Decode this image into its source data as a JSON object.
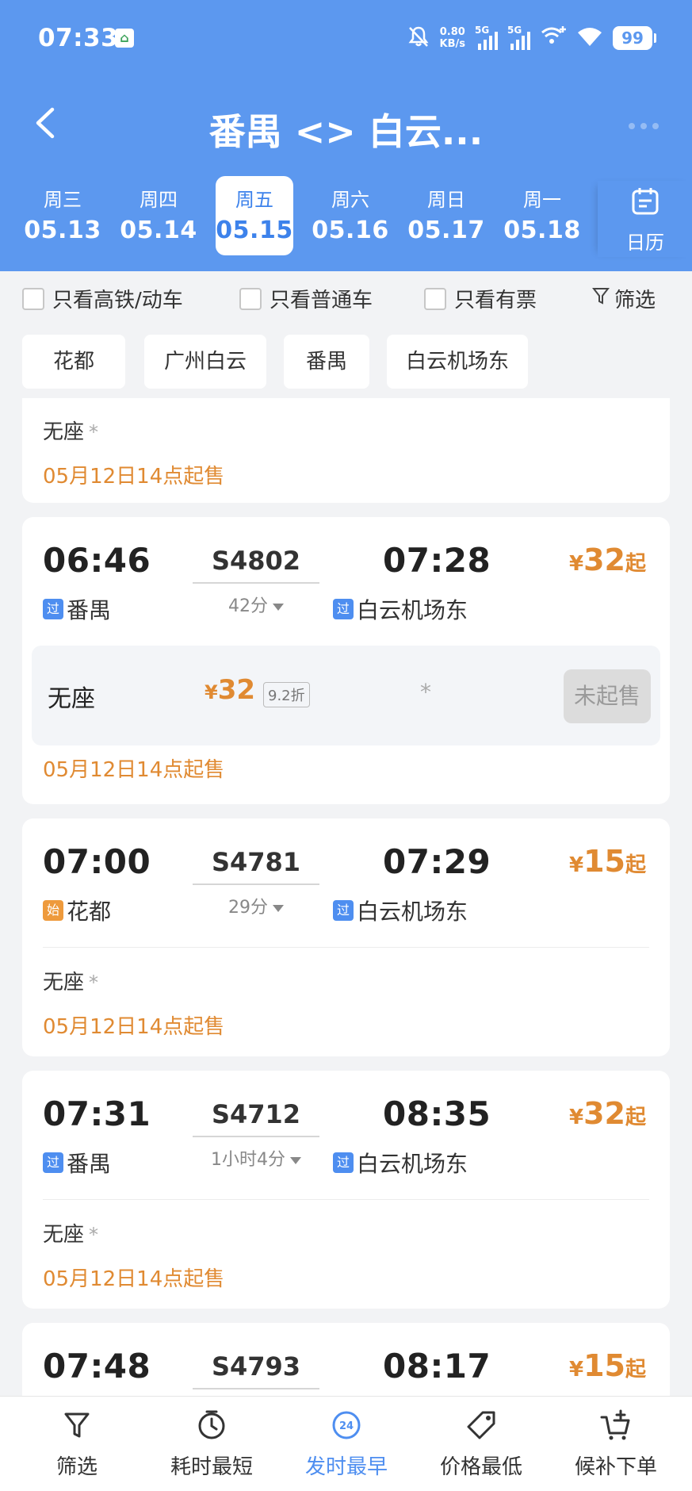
{
  "status_bar": {
    "time": "07:33",
    "net_speed_value": "0.80",
    "net_speed_unit": "KB/s",
    "sim1": "5G",
    "sim2": "5G",
    "battery": "99"
  },
  "header": {
    "title": "番禺 <> 白云...",
    "calendar_label": "日历",
    "dates": [
      {
        "weekday": "周三",
        "date": "05.13",
        "selected": false
      },
      {
        "weekday": "周四",
        "date": "05.14",
        "selected": false
      },
      {
        "weekday": "周五",
        "date": "05.15",
        "selected": true
      },
      {
        "weekday": "周六",
        "date": "05.16",
        "selected": false
      },
      {
        "weekday": "周日",
        "date": "05.17",
        "selected": false
      },
      {
        "weekday": "周一",
        "date": "05.18",
        "selected": false
      }
    ]
  },
  "filters": {
    "high_speed": "只看高铁/动车",
    "regular": "只看普通车",
    "available": "只看有票",
    "filter_button": "筛选"
  },
  "stations": [
    "花都",
    "广州白云",
    "番禺",
    "白云机场东"
  ],
  "partial_card": {
    "seat": "无座",
    "star": "*",
    "sale_notice": "05月12日14点起售"
  },
  "trains": [
    {
      "depart_time": "06:46",
      "train_no": "S4802",
      "arrive_time": "07:28",
      "duration": "42分",
      "from_badge": "过",
      "from_station": "番禺",
      "to_badge": "过",
      "to_station": "白云机场东",
      "price_symbol": "¥",
      "price": "32",
      "price_suffix": "起",
      "seat": {
        "name": "无座",
        "price": "32",
        "discount": "9.2折",
        "star": "*",
        "action": "未起售"
      },
      "sale_notice": "05月12日14点起售"
    },
    {
      "depart_time": "07:00",
      "train_no": "S4781",
      "arrive_time": "07:29",
      "duration": "29分",
      "from_badge": "始",
      "from_station": "花都",
      "to_badge": "过",
      "to_station": "白云机场东",
      "price_symbol": "¥",
      "price": "15",
      "price_suffix": "起",
      "seat_summary": "无座",
      "star": "*",
      "sale_notice": "05月12日14点起售"
    },
    {
      "depart_time": "07:31",
      "train_no": "S4712",
      "arrive_time": "08:35",
      "duration": "1小时4分",
      "from_badge": "过",
      "from_station": "番禺",
      "to_badge": "过",
      "to_station": "白云机场东",
      "price_symbol": "¥",
      "price": "32",
      "price_suffix": "起",
      "seat_summary": "无座",
      "star": "*",
      "sale_notice": "05月12日14点起售"
    },
    {
      "depart_time": "07:48",
      "train_no": "S4793",
      "arrive_time": "08:17",
      "price_symbol": "¥",
      "price": "15",
      "price_suffix": "起"
    }
  ],
  "tabbar": {
    "tabs": [
      {
        "label": "筛选",
        "icon": "funnel-icon"
      },
      {
        "label": "耗时最短",
        "icon": "clock-icon"
      },
      {
        "label": "发时最早",
        "icon": "24h-icon",
        "icon_text": "24",
        "active": true
      },
      {
        "label": "价格最低",
        "icon": "price-tag-icon"
      },
      {
        "label": "候补下单",
        "icon": "cart-add-icon"
      }
    ]
  },
  "colors": {
    "header_blue": "#5c98ef",
    "accent_blue": "#4e8ef0",
    "price_orange": "#e08a32"
  }
}
